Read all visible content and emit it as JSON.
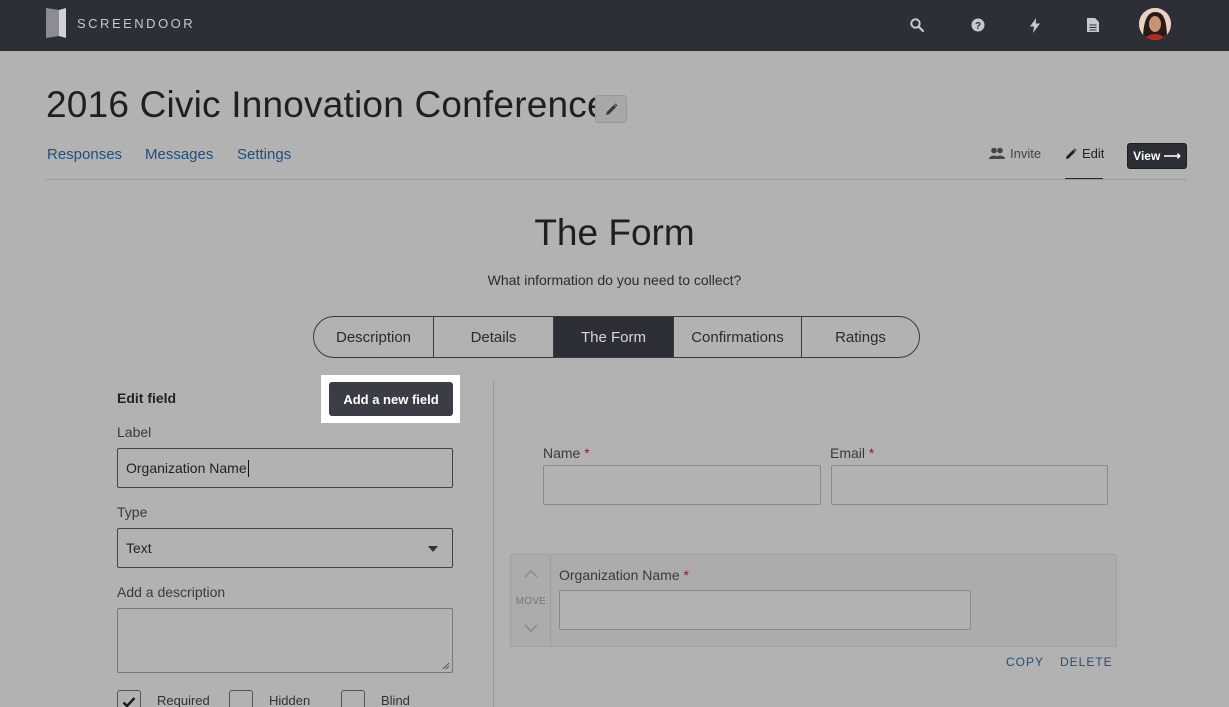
{
  "app": {
    "brand": "SCREENDOOR"
  },
  "topbar": {
    "icons": [
      "search-icon",
      "help-icon",
      "bolt-icon",
      "document-icon"
    ],
    "avatar_alt": "avatar"
  },
  "project": {
    "title": "2016 Civic Innovation Conference"
  },
  "subnav": {
    "responses": "Responses",
    "messages": "Messages",
    "settings": "Settings",
    "invite": "Invite",
    "edit": "Edit",
    "view": "View ⟶"
  },
  "section": {
    "title": "The Form",
    "subtitle": "What information do you need to collect?"
  },
  "tabs": [
    {
      "label": "Description",
      "active": false
    },
    {
      "label": "Details",
      "active": false
    },
    {
      "label": "The Form",
      "active": true
    },
    {
      "label": "Confirmations",
      "active": false
    },
    {
      "label": "Ratings",
      "active": false
    }
  ],
  "editor": {
    "heading": "Edit field",
    "add_button": "Add a new field",
    "label_caption": "Label",
    "label_value": "Organization Name",
    "type_caption": "Type",
    "type_value": "Text",
    "description_caption": "Add a description",
    "description_value": "",
    "options": [
      {
        "label": "Required",
        "checked": true
      },
      {
        "label": "Hidden",
        "checked": false
      },
      {
        "label": "Blind",
        "checked": false
      }
    ]
  },
  "preview": {
    "fields": [
      {
        "label": "Name",
        "required_mark": "*"
      },
      {
        "label": "Email",
        "required_mark": "*"
      },
      {
        "label": "Organization Name",
        "required_mark": "*"
      }
    ],
    "move_label": "MOVE",
    "copy_label": "COPY",
    "delete_label": "DELETE"
  },
  "colors": {
    "topbar": "#2c2f36",
    "link": "#1f4e7c",
    "required": "#8b1e1e",
    "overlay_background": "#b2b2b2"
  }
}
